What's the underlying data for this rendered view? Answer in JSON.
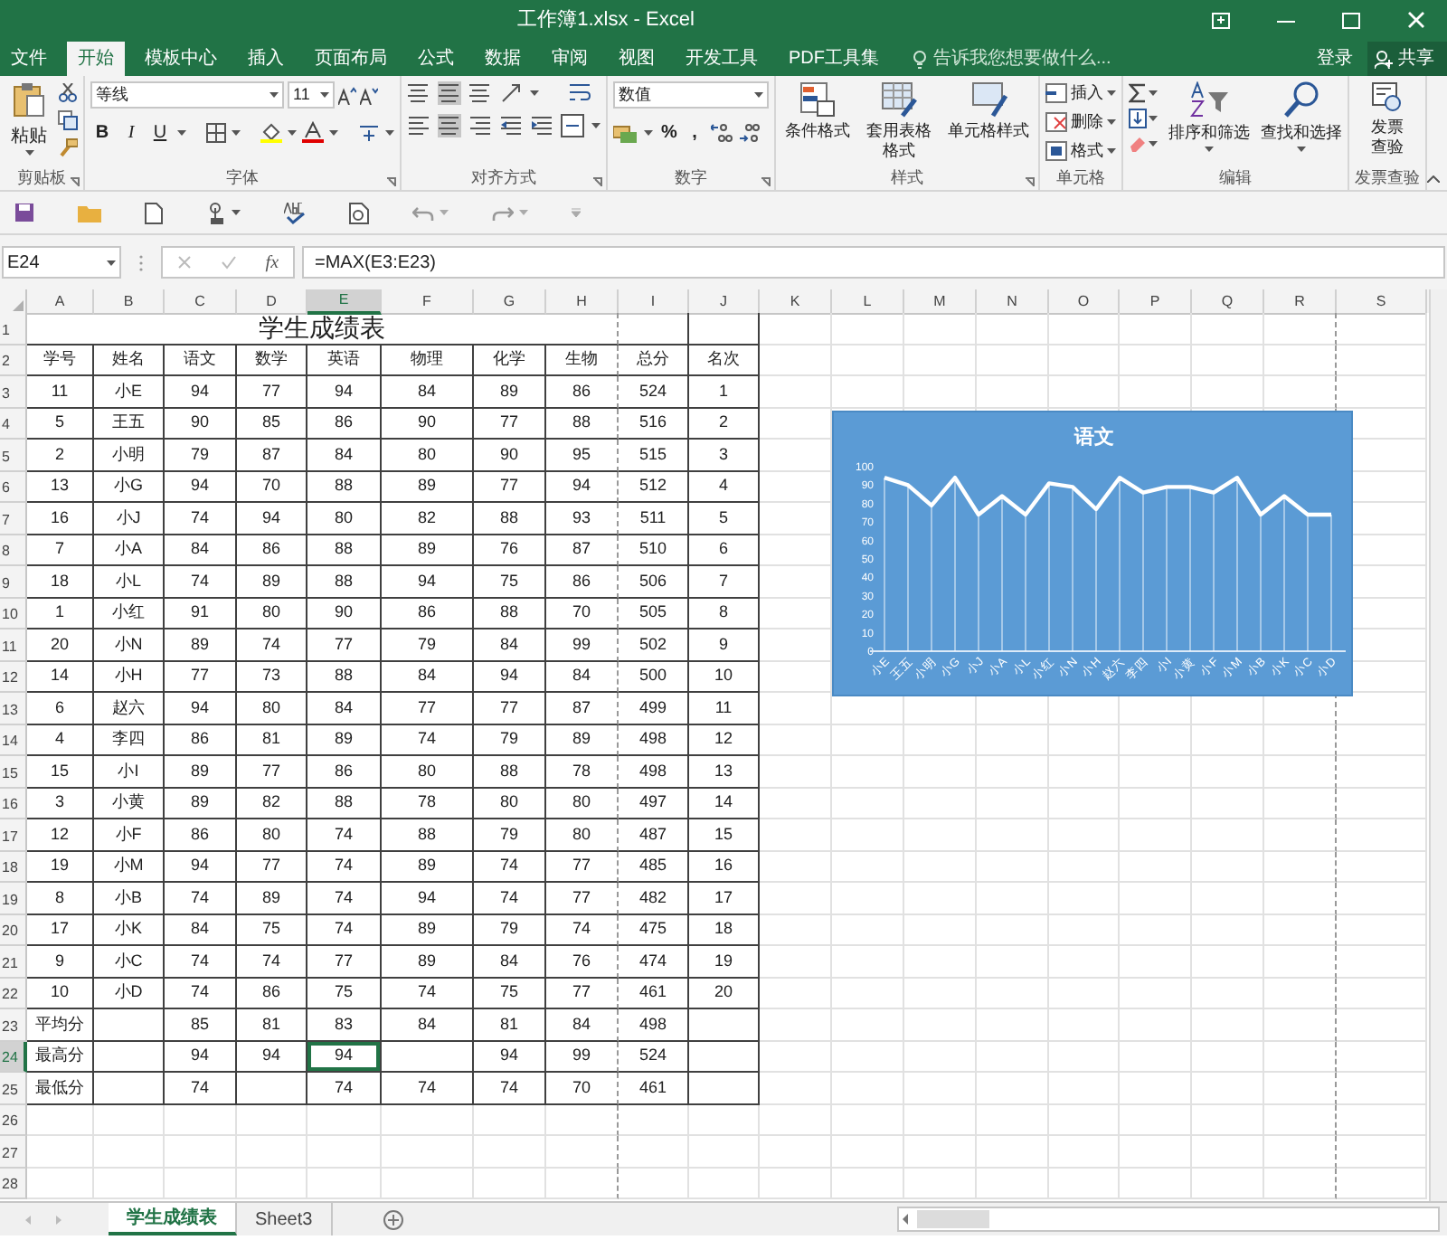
{
  "window": {
    "title": "工作簿1.xlsx - Excel"
  },
  "menu_tabs": [
    {
      "label": "文件",
      "selected": false
    },
    {
      "label": "开始",
      "selected": true
    },
    {
      "label": "模板中心",
      "selected": false
    },
    {
      "label": "插入",
      "selected": false
    },
    {
      "label": "页面布局",
      "selected": false
    },
    {
      "label": "公式",
      "selected": false
    },
    {
      "label": "数据",
      "selected": false
    },
    {
      "label": "审阅",
      "selected": false
    },
    {
      "label": "视图",
      "selected": false
    },
    {
      "label": "开发工具",
      "selected": false
    },
    {
      "label": "PDF工具集",
      "selected": false
    }
  ],
  "tell_me": {
    "placeholder": "告诉我您想要做什么..."
  },
  "account": {
    "login": "登录",
    "share": "共享"
  },
  "ribbon": {
    "clipboard": {
      "paste": "粘贴",
      "label": "剪贴板"
    },
    "font": {
      "font_name": "等线",
      "font_size": "11",
      "style_buttons": [
        "B",
        "I",
        "U"
      ],
      "label": "字体"
    },
    "alignment": {
      "label": "对齐方式"
    },
    "number": {
      "format": "数值",
      "symbols": [
        "%",
        ","
      ],
      "label": "数字"
    },
    "styles": {
      "buttons": [
        "条件格式",
        "套用表格格式",
        "单元格样式"
      ],
      "label": "样式"
    },
    "cells": {
      "buttons": [
        "插入",
        "删除",
        "格式"
      ],
      "label": "单元格"
    },
    "editing": {
      "buttons": [
        "排序和筛选",
        "查找和选择"
      ],
      "label": "编辑"
    },
    "invoice": {
      "button": "发票查验",
      "label": "发票查验"
    }
  },
  "formula_bar": {
    "name_box": "E24",
    "fx_label": "fx",
    "formula": "=MAX(E3:E23)"
  },
  "columns": [
    {
      "label": "A",
      "selected": false
    },
    {
      "label": "B",
      "selected": false
    },
    {
      "label": "C",
      "selected": false
    },
    {
      "label": "D",
      "selected": false
    },
    {
      "label": "E",
      "selected": true
    },
    {
      "label": "F",
      "selected": false
    },
    {
      "label": "G",
      "selected": false
    },
    {
      "label": "H",
      "selected": false
    },
    {
      "label": "I",
      "selected": false
    },
    {
      "label": "J",
      "selected": false
    },
    {
      "label": "K",
      "selected": false
    },
    {
      "label": "L",
      "selected": false
    },
    {
      "label": "M",
      "selected": false
    },
    {
      "label": "N",
      "selected": false
    },
    {
      "label": "O",
      "selected": false
    },
    {
      "label": "P",
      "selected": false
    },
    {
      "label": "Q",
      "selected": false
    },
    {
      "label": "R",
      "selected": false
    },
    {
      "label": "S",
      "selected": false
    }
  ],
  "row_numbers": [
    {
      "label": "1",
      "selected": false
    },
    {
      "label": "2",
      "selected": false
    },
    {
      "label": "3",
      "selected": false
    },
    {
      "label": "4",
      "selected": false
    },
    {
      "label": "5",
      "selected": false
    },
    {
      "label": "6",
      "selected": false
    },
    {
      "label": "7",
      "selected": false
    },
    {
      "label": "8",
      "selected": false
    },
    {
      "label": "9",
      "selected": false
    },
    {
      "label": "10",
      "selected": false
    },
    {
      "label": "11",
      "selected": false
    },
    {
      "label": "12",
      "selected": false
    },
    {
      "label": "13",
      "selected": false
    },
    {
      "label": "14",
      "selected": false
    },
    {
      "label": "15",
      "selected": false
    },
    {
      "label": "16",
      "selected": false
    },
    {
      "label": "17",
      "selected": false
    },
    {
      "label": "18",
      "selected": false
    },
    {
      "label": "19",
      "selected": false
    },
    {
      "label": "20",
      "selected": false
    },
    {
      "label": "21",
      "selected": false
    },
    {
      "label": "22",
      "selected": false
    },
    {
      "label": "23",
      "selected": false
    },
    {
      "label": "24",
      "selected": true
    },
    {
      "label": "25",
      "selected": false
    },
    {
      "label": "26",
      "selected": false
    },
    {
      "label": "27",
      "selected": false
    },
    {
      "label": "28",
      "selected": false
    }
  ],
  "sheet": {
    "title": "学生成绩表",
    "headers": [
      "学号",
      "姓名",
      "语文",
      "数学",
      "英语",
      "物理",
      "化学",
      "生物",
      "总分",
      "名次"
    ],
    "rows": [
      [
        "11",
        "小E",
        "94",
        "77",
        "94",
        "84",
        "89",
        "86",
        "524",
        "1"
      ],
      [
        "5",
        "王五",
        "90",
        "85",
        "86",
        "90",
        "77",
        "88",
        "516",
        "2"
      ],
      [
        "2",
        "小明",
        "79",
        "87",
        "84",
        "80",
        "90",
        "95",
        "515",
        "3"
      ],
      [
        "13",
        "小G",
        "94",
        "70",
        "88",
        "89",
        "77",
        "94",
        "512",
        "4"
      ],
      [
        "16",
        "小J",
        "74",
        "94",
        "80",
        "82",
        "88",
        "93",
        "511",
        "5"
      ],
      [
        "7",
        "小A",
        "84",
        "86",
        "88",
        "89",
        "76",
        "87",
        "510",
        "6"
      ],
      [
        "18",
        "小L",
        "74",
        "89",
        "88",
        "94",
        "75",
        "86",
        "506",
        "7"
      ],
      [
        "1",
        "小红",
        "91",
        "80",
        "90",
        "86",
        "88",
        "70",
        "505",
        "8"
      ],
      [
        "20",
        "小N",
        "89",
        "74",
        "77",
        "79",
        "84",
        "99",
        "502",
        "9"
      ],
      [
        "14",
        "小H",
        "77",
        "73",
        "88",
        "84",
        "94",
        "84",
        "500",
        "10"
      ],
      [
        "6",
        "赵六",
        "94",
        "80",
        "84",
        "77",
        "77",
        "87",
        "499",
        "11"
      ],
      [
        "4",
        "李四",
        "86",
        "81",
        "89",
        "74",
        "79",
        "89",
        "498",
        "12"
      ],
      [
        "15",
        "小I",
        "89",
        "77",
        "86",
        "80",
        "88",
        "78",
        "498",
        "13"
      ],
      [
        "3",
        "小黄",
        "89",
        "82",
        "88",
        "78",
        "80",
        "80",
        "497",
        "14"
      ],
      [
        "12",
        "小F",
        "86",
        "80",
        "74",
        "88",
        "79",
        "80",
        "487",
        "15"
      ],
      [
        "19",
        "小M",
        "94",
        "77",
        "74",
        "89",
        "74",
        "77",
        "485",
        "16"
      ],
      [
        "8",
        "小B",
        "74",
        "89",
        "74",
        "94",
        "74",
        "77",
        "482",
        "17"
      ],
      [
        "17",
        "小K",
        "84",
        "75",
        "74",
        "89",
        "79",
        "74",
        "475",
        "18"
      ],
      [
        "9",
        "小C",
        "74",
        "74",
        "77",
        "89",
        "84",
        "76",
        "474",
        "19"
      ],
      [
        "10",
        "小D",
        "74",
        "86",
        "75",
        "74",
        "75",
        "77",
        "461",
        "20"
      ]
    ],
    "summary": [
      {
        "label": "平均分",
        "cells": [
          {
            "text": null,
            "selected": false
          },
          {
            "text": "85",
            "selected": false
          },
          {
            "text": "81",
            "selected": false
          },
          {
            "text": "83",
            "selected": false
          },
          {
            "text": "84",
            "selected": false
          },
          {
            "text": "81",
            "selected": false
          },
          {
            "text": "84",
            "selected": false
          },
          {
            "text": "498",
            "selected": false
          },
          {
            "text": null,
            "selected": false
          }
        ]
      },
      {
        "label": "最高分",
        "cells": [
          {
            "text": null,
            "selected": false
          },
          {
            "text": "94",
            "selected": false
          },
          {
            "text": "94",
            "selected": false
          },
          {
            "text": "94",
            "selected": true
          },
          {
            "text": null,
            "selected": false
          },
          {
            "text": "94",
            "selected": false
          },
          {
            "text": "99",
            "selected": false
          },
          {
            "text": "524",
            "selected": false
          },
          {
            "text": null,
            "selected": false
          }
        ]
      },
      {
        "label": "最低分",
        "cells": [
          {
            "text": null,
            "selected": false
          },
          {
            "text": "74",
            "selected": false
          },
          {
            "text": null,
            "selected": false
          },
          {
            "text": "74",
            "selected": false
          },
          {
            "text": "74",
            "selected": false
          },
          {
            "text": "74",
            "selected": false
          },
          {
            "text": "70",
            "selected": false
          },
          {
            "text": "461",
            "selected": false
          },
          {
            "text": null,
            "selected": false
          }
        ]
      }
    ]
  },
  "chart": {
    "chart_data": {
      "type": "line",
      "title": "语文",
      "categories": [
        "小E",
        "王五",
        "小明",
        "小G",
        "小J",
        "小A",
        "小L",
        "小红",
        "小N",
        "小H",
        "赵六",
        "李四",
        "小I",
        "小黄",
        "小F",
        "小M",
        "小B",
        "小K",
        "小C",
        "小D"
      ],
      "series": [
        {
          "color": "#ffffff",
          "values": [
            94,
            90,
            79,
            94,
            74,
            84,
            74,
            91,
            89,
            77,
            94,
            86,
            89,
            89,
            86,
            94,
            74,
            84,
            74,
            74
          ]
        }
      ],
      "grid": true,
      "ylim": [
        0,
        100
      ],
      "yticks": [
        0,
        10,
        20,
        30,
        40,
        50,
        60,
        70,
        80,
        90,
        100
      ]
    }
  },
  "sheet_tabs": [
    {
      "label": "学生成绩表",
      "selected": true
    },
    {
      "label": "Sheet3",
      "selected": false
    }
  ]
}
